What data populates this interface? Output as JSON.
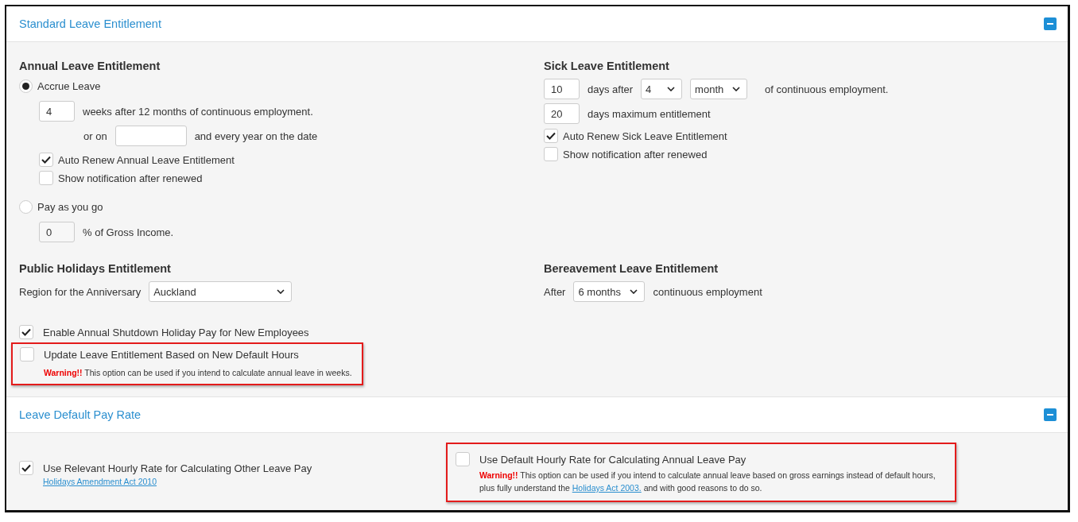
{
  "standard": {
    "title": "Standard Leave Entitlement",
    "expanded": true,
    "annual": {
      "heading": "Annual Leave Entitlement",
      "options": [
        {
          "kind": "accrue",
          "label": "Accrue Leave",
          "selected": true,
          "weeks": "4",
          "weeks_text": "weeks after 12 months of continuous employment.",
          "or_on": "or on",
          "date_text": "and every year on the date",
          "checks": [
            {
              "label": "Auto Renew Annual Leave Entitlement",
              "checked": true
            },
            {
              "label": "Show notification after renewed",
              "checked": false
            }
          ]
        },
        {
          "kind": "percent",
          "label": "Pay as you go",
          "selected": false,
          "percent": "0",
          "percent_text": "% of Gross Income."
        }
      ]
    },
    "sick": {
      "heading": "Sick Leave Entitlement",
      "days": "10",
      "days_after": "days after",
      "count": "4",
      "unit": "month",
      "tail": "of continuous employment.",
      "max": "20",
      "max_text": "days maximum entitlement",
      "checks": [
        {
          "label": "Auto Renew Sick Leave Entitlement",
          "checked": true
        },
        {
          "label": "Show notification after renewed",
          "checked": false
        }
      ]
    },
    "public": {
      "heading": "Public Holidays Entitlement",
      "region_label": "Region for the Anniversary",
      "region": "Auckland"
    },
    "bereavement": {
      "heading": "Bereavement Leave Entitlement",
      "after": "After",
      "period": "6 months",
      "tail": "continuous employment"
    },
    "options": [
      {
        "label": "Enable Annual Shutdown Holiday Pay for New Employees",
        "checked": true,
        "highlighted": false
      },
      {
        "label": "Update Leave Entitlement Based on New Default Hours",
        "checked": false,
        "highlighted": true,
        "warning": {
          "label": "Warning!!",
          "text": "This option can be used if you intend to calculate annual leave in weeks."
        }
      }
    ]
  },
  "pay_rate": {
    "title": "Leave Default Pay Rate",
    "expanded": true,
    "options": [
      {
        "label": "Use Relevant Hourly Rate for Calculating Other Leave Pay",
        "checked": true,
        "highlighted": false,
        "link": "Holidays Amendment Act 2010"
      },
      {
        "label": "Use Default Hourly Rate for Calculating Annual Leave Pay",
        "checked": false,
        "highlighted": true,
        "warning": {
          "label": "Warning!!",
          "text": "This option can be used if you intend to calculate annual leave based on gross earnings instead of default hours, plus fully understand the",
          "link": "Holidays Act 2003.",
          "after": "and with good reasons to do so."
        }
      }
    ]
  }
}
